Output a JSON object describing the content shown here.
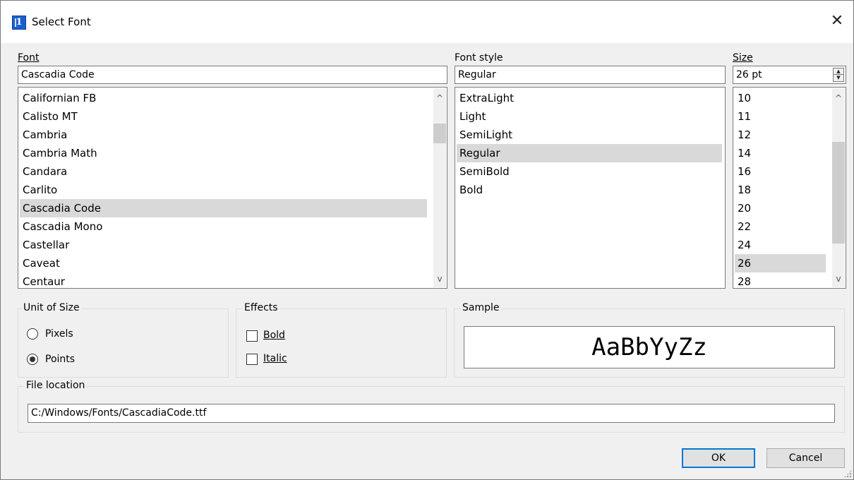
{
  "window": {
    "title": "Select Font",
    "close_glyph": "✕",
    "app_icon_char": "1"
  },
  "font": {
    "label": "Font",
    "value": "Cascadia Code",
    "items": [
      "Californian FB",
      "Calisto MT",
      "Cambria",
      "Cambria Math",
      "Candara",
      "Carlito",
      "Cascadia Code",
      "Cascadia Mono",
      "Castellar",
      "Caveat",
      "Centaur"
    ],
    "selected": "Cascadia Code"
  },
  "style": {
    "label": "Font style",
    "value": "Regular",
    "items": [
      "ExtraLight",
      "Light",
      "SemiLight",
      "Regular",
      "SemiBold",
      "Bold"
    ],
    "selected": "Regular"
  },
  "size": {
    "label": "Size",
    "value": "26 pt",
    "items": [
      "10",
      "11",
      "12",
      "14",
      "16",
      "18",
      "20",
      "22",
      "24",
      "26",
      "28"
    ],
    "selected": "26"
  },
  "unit_of_size": {
    "title": "Unit of Size",
    "pixels": "Pixels",
    "points": "Points",
    "selected": "Points"
  },
  "effects": {
    "title": "Effects",
    "bold": "Bold",
    "italic": "Italic",
    "bold_checked": false,
    "italic_checked": false
  },
  "sample": {
    "title": "Sample",
    "text": "AaBbYyZz"
  },
  "file_location": {
    "title": "File location",
    "value": "C:/Windows/Fonts/CascadiaCode.ttf"
  },
  "buttons": {
    "ok": "OK",
    "cancel": "Cancel"
  },
  "icons": {
    "scroll_up": "^",
    "scroll_down": "v",
    "spin_up": "▲",
    "spin_down": "▼"
  },
  "colors": {
    "accent": "#0078d7",
    "selection": "#d9d9d9",
    "app_icon": "#1a5fd0"
  }
}
